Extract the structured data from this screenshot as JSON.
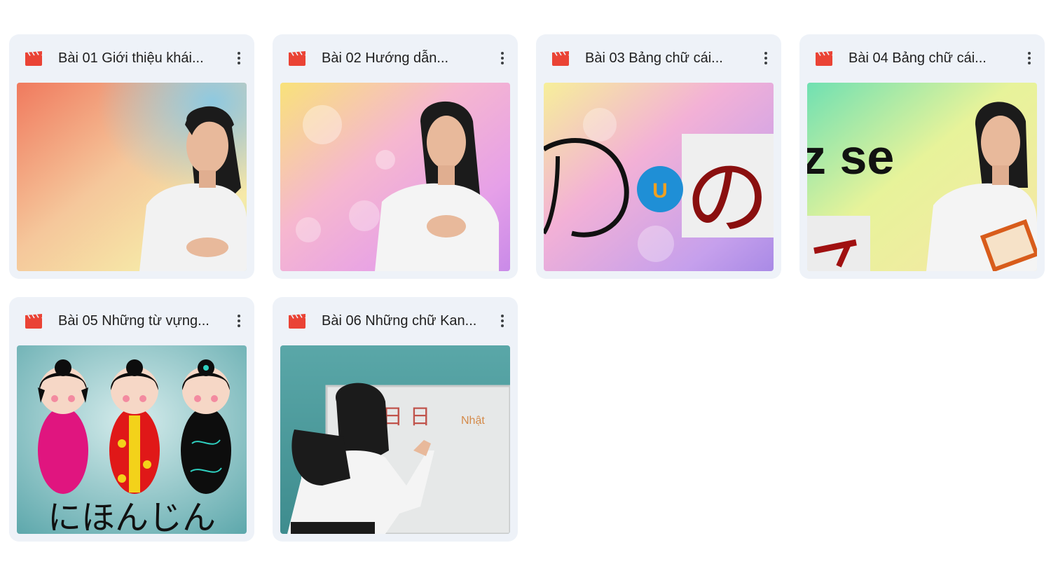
{
  "files": [
    {
      "title": "Bài 01 Giới thiệu khái...",
      "icon": "video-file-icon",
      "thumbnail": "woman-presenter-colorful-background"
    },
    {
      "title": "Bài 02 Hướng dẫn...",
      "icon": "video-file-icon",
      "thumbnail": "woman-presenter-bokeh-background"
    },
    {
      "title": "Bài 03 Bảng chữ cái...",
      "icon": "video-file-icon",
      "thumbnail": "hiragana-no-letter"
    },
    {
      "title": "Bài 04 Bảng chữ cái...",
      "icon": "video-file-icon",
      "thumbnail": "woman-reading-card"
    },
    {
      "title": "Bài 05 Những từ vựng...",
      "icon": "video-file-icon",
      "thumbnail": "kokeshi-dolls"
    },
    {
      "title": "Bài 06 Những chữ Kan...",
      "icon": "video-file-icon",
      "thumbnail": "woman-writing-whiteboard"
    }
  ],
  "thumbnail_text": {
    "file3_letter": "の",
    "file3_badge": "U",
    "file4_text": "z se",
    "file5_text": "にほんじん",
    "file6_board": "日 日",
    "file6_note": "Nhật"
  },
  "colors": {
    "card_bg": "#eef2f8",
    "icon_red": "#ea4335",
    "title_text": "#1f1f1f"
  }
}
